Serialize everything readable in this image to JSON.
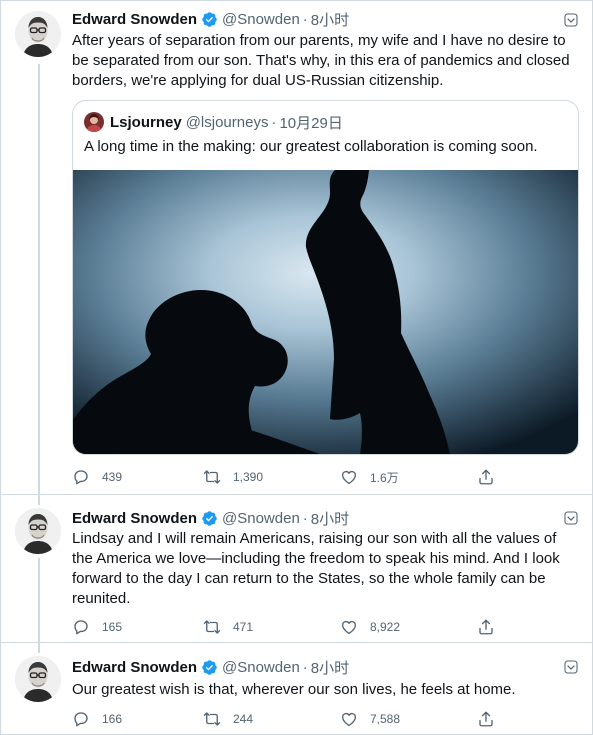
{
  "colors": {
    "verified_badge": "#1d9bf0",
    "text_primary": "#0f1419",
    "text_secondary": "#536471",
    "border": "#cfd9de"
  },
  "tweets": [
    {
      "author": {
        "name": "Edward Snowden",
        "handle": "@Snowden",
        "verified": true
      },
      "separator": "·",
      "time": "8小时",
      "text": "After years of separation from our parents, my wife and I have no desire to be separated from our son. That's why, in this era of pandemics and closed borders, we're applying for dual US-Russian citizenship.",
      "quote": {
        "author": {
          "name": "Lsjourney",
          "handle": "@lsjourneys"
        },
        "separator": "·",
        "time": "10月29日",
        "text": "A long time in the making: our greatest collaboration is coming soon."
      },
      "stats": {
        "replies": "439",
        "retweets": "1,390",
        "likes": "1.6万"
      }
    },
    {
      "author": {
        "name": "Edward Snowden",
        "handle": "@Snowden",
        "verified": true
      },
      "separator": "·",
      "time": "8小时",
      "text": "Lindsay and I will remain Americans, raising our son with all the values of the America we love—including the freedom to speak his mind. And I look forward to the day I can return to the States, so the whole family can be reunited.",
      "stats": {
        "replies": "165",
        "retweets": "471",
        "likes": "8,922"
      }
    },
    {
      "author": {
        "name": "Edward Snowden",
        "handle": "@Snowden",
        "verified": true
      },
      "separator": "·",
      "time": "8小时",
      "text": "Our greatest wish is that, wherever our son lives, he feels at home.",
      "stats": {
        "replies": "166",
        "retweets": "244",
        "likes": "7,588"
      }
    }
  ],
  "icons": {
    "verified": "verified-badge-icon",
    "more": "more-options-icon",
    "reply": "reply-icon",
    "retweet": "retweet-icon",
    "like": "heart-icon",
    "share": "share-icon"
  }
}
